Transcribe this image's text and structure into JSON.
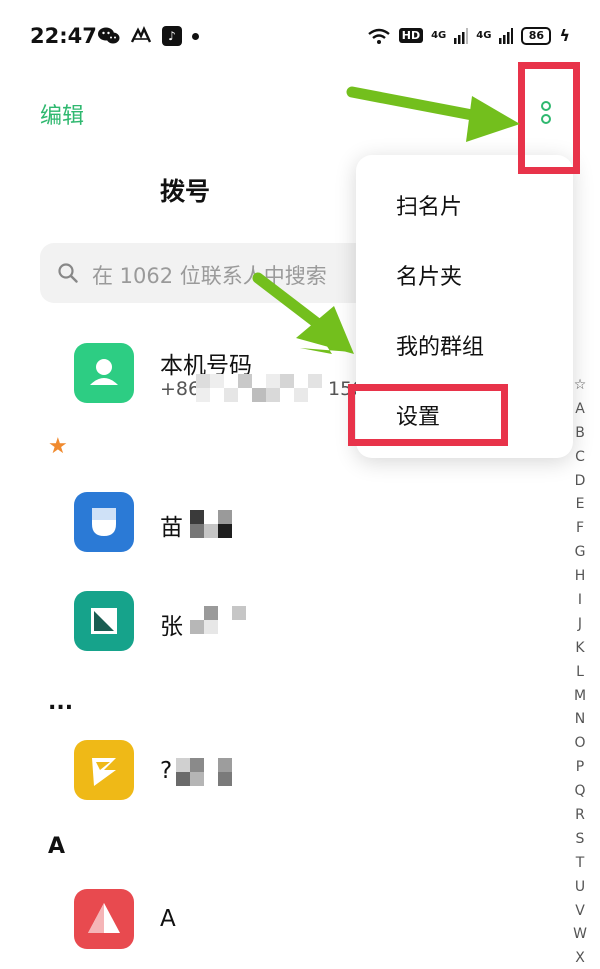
{
  "status_bar": {
    "time": "22:47",
    "app_icons": [
      "wechat-icon",
      "app-icon",
      "tiktok-icon",
      "notification-dot"
    ],
    "hd_label": "HD",
    "network_labels": [
      "4G",
      "4G"
    ],
    "battery_level": "86"
  },
  "header": {
    "edit_label": "编辑",
    "title": "拨号"
  },
  "search": {
    "placeholder": "在 1062 位联系人中搜索"
  },
  "my_number": {
    "name": "本机号码",
    "phone_prefix": "+86",
    "phone_suffix": "150"
  },
  "sections": {
    "favorites_symbol": "★",
    "other_symbol": "...",
    "a_label": "A"
  },
  "contacts": [
    {
      "name_prefix": "苗",
      "color": "#2b7ad6"
    },
    {
      "name_prefix": "张",
      "color": "#16a38b"
    },
    {
      "name_prefix": "?",
      "color": "#efb917"
    },
    {
      "name_prefix": "A",
      "color": "#e84a4f"
    }
  ],
  "menu": {
    "items": [
      "扫名片",
      "名片夹",
      "我的群组",
      "设置"
    ]
  },
  "alphabet": [
    "☆",
    "A",
    "B",
    "C",
    "D",
    "E",
    "F",
    "G",
    "H",
    "I",
    "J",
    "K",
    "L",
    "M",
    "N",
    "O",
    "P",
    "Q",
    "R",
    "S",
    "T",
    "U",
    "V",
    "W",
    "X"
  ],
  "colors": {
    "accent": "#2fb86f",
    "highlight": "#e8334a",
    "arrow": "#73bf1d"
  }
}
